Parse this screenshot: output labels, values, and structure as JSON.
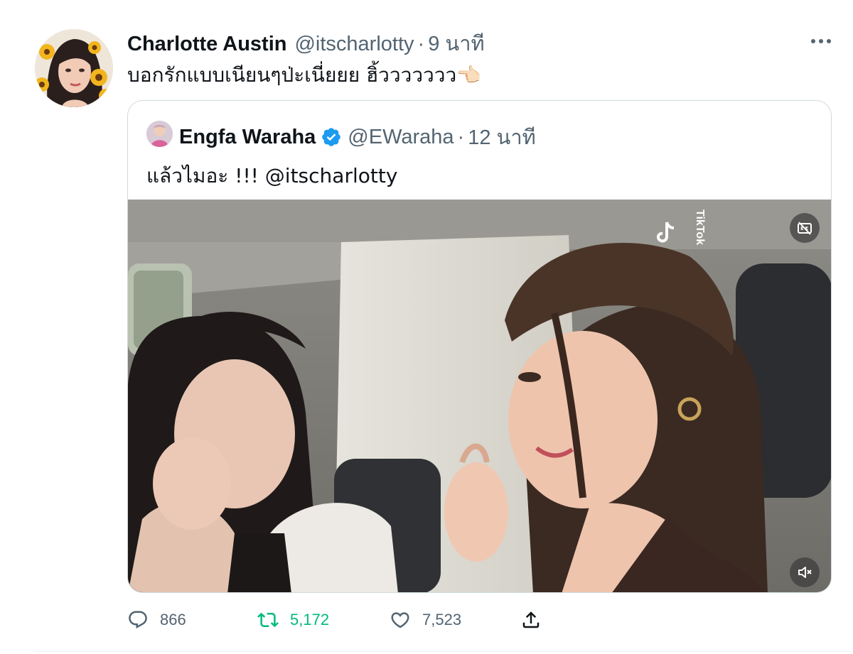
{
  "tweet": {
    "author_name": "Charlotte Austin",
    "author_handle": "@itscharlotty",
    "separator": "·",
    "time": "9 นาที",
    "text": "บอกรักแบบเนียนๆป่ะเนี่ยยย ฮิ้ววววววว👈🏻"
  },
  "quote": {
    "author_name": "Engfa Waraha",
    "author_handle": "@EWaraha",
    "separator": "·",
    "time": "12 นาที",
    "text_prefix": "แล้วไมอะ !!! ",
    "mention": "@itscharlotty",
    "video": {
      "watermark": "TikTok",
      "captions_icon": "closed-captions-off-icon",
      "mute_icon": "volume-muted-icon"
    }
  },
  "actions": {
    "replies": "866",
    "retweets": "5,172",
    "likes": "7,523"
  },
  "colors": {
    "text_primary": "#0f1419",
    "text_secondary": "#536471",
    "retweet_green": "#00ba7c",
    "verified_blue": "#1d9bf0",
    "border": "#cfd9de"
  },
  "icons": {
    "more": "more-dots-icon",
    "reply": "reply-bubble-icon",
    "retweet": "retweet-icon",
    "like": "heart-icon",
    "share": "share-upload-icon",
    "verified": "verified-badge-icon"
  }
}
